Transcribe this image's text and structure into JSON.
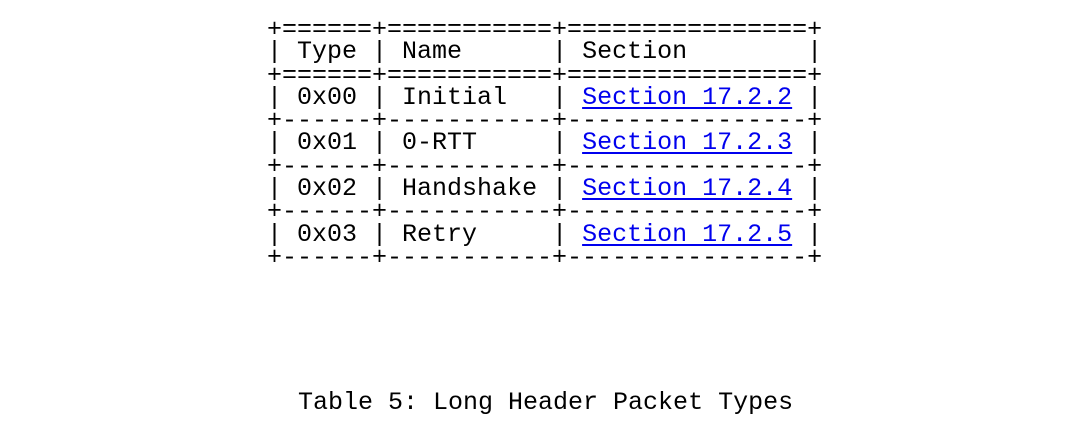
{
  "table": {
    "border_heavy": "+======+===========+================+",
    "border_light": "+------+-----------+----------------+",
    "header": {
      "type": "Type",
      "name": "Name",
      "section": "Section"
    },
    "rows": [
      {
        "type": "0x00",
        "name": "Initial",
        "section": "Section 17.2.2"
      },
      {
        "type": "0x01",
        "name": "0-RTT",
        "section": "Section 17.2.3"
      },
      {
        "type": "0x02",
        "name": "Handshake",
        "section": "Section 17.2.4"
      },
      {
        "type": "0x03",
        "name": "Retry",
        "section": "Section 17.2.5"
      }
    ]
  },
  "caption": "Table 5: Long Header Packet Types",
  "colors": {
    "link": "#0000ee",
    "text": "#000000",
    "background": "#ffffff"
  }
}
